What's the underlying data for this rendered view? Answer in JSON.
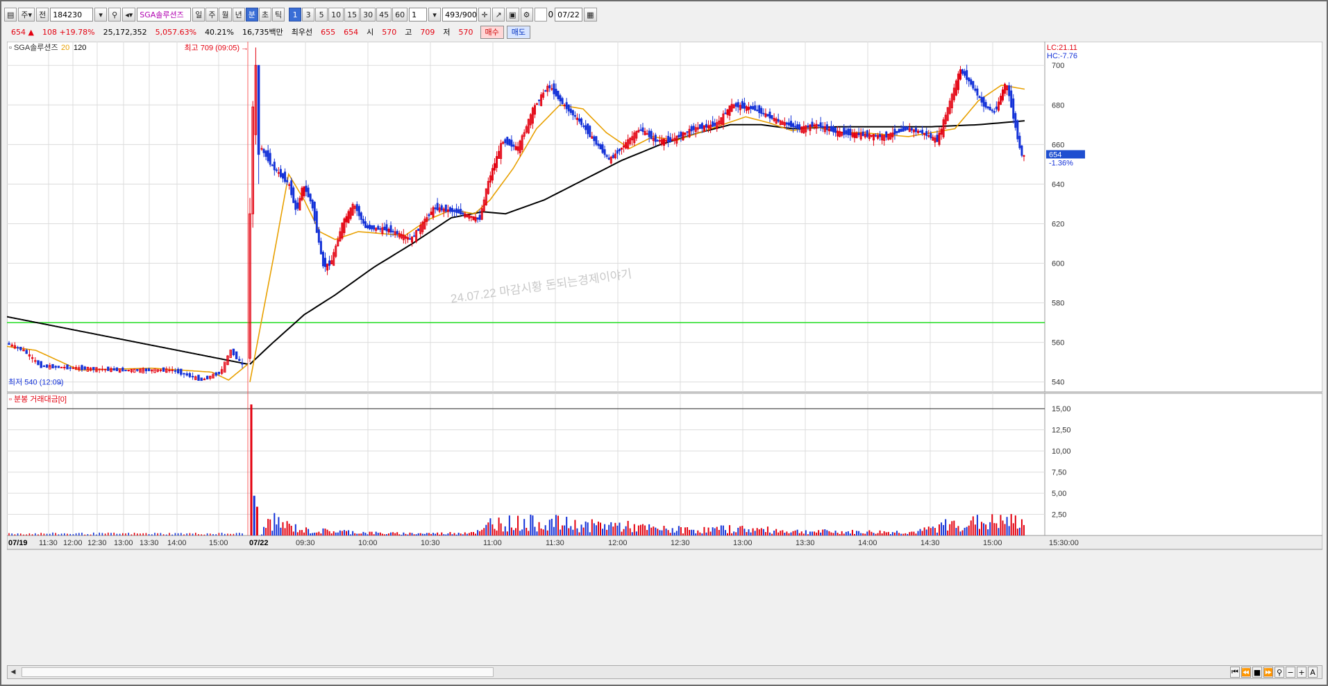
{
  "toolbar": {
    "type_code": "주",
    "market": "전",
    "code": "184230",
    "name": "SGA솔루션즈",
    "periods": [
      "일",
      "주",
      "월",
      "년",
      "분",
      "초",
      "틱"
    ],
    "selected_period": "분",
    "intervals": [
      "1",
      "3",
      "5",
      "10",
      "15",
      "30",
      "45",
      "60"
    ],
    "selected_interval": "1",
    "interval_select": "1",
    "count": "493",
    "count_total": "/900",
    "date": "07/22",
    "check_label": "0"
  },
  "quote": {
    "price": "654",
    "arrow": "▲",
    "change": "108",
    "change_pct": "+19.78%",
    "volume": "25,172,352",
    "vol_ratio": "5,057.63%",
    "turnover": "40.21%",
    "amount": "16,735백만",
    "best_label": "최우선",
    "ask": "655",
    "bid": "654",
    "open_label": "시",
    "open": "570",
    "high_label": "고",
    "high": "709",
    "low_label": "저",
    "low": "570",
    "buy_label": "매수",
    "sell_label": "매도"
  },
  "colors": {
    "up": "#e3000f",
    "down": "#1432d8",
    "ma20": "#e8a000",
    "ma120": "#000000",
    "hline": "#22dd22",
    "grid": "#dcdcdc"
  },
  "chart_data": [
    {
      "type": "candlestick",
      "legend": [
        "SGA솔루션즈",
        "20",
        "120"
      ],
      "high_marker": "최고 709 (09:05)",
      "low_marker": "최저 540 (12:09)",
      "right_top": [
        "LC:21.11",
        "HC:-7.76"
      ],
      "current": {
        "price": "654",
        "pct": "-1.36%"
      },
      "watermark": "24.07.22 마감시황   돈되는경제이야기",
      "yticks": [
        700,
        680,
        660,
        640,
        620,
        600,
        580,
        560,
        540
      ],
      "ylim": [
        535,
        712
      ],
      "reference_line": 570,
      "day1": {
        "open": 560,
        "close": 547,
        "high": 563,
        "low": 540
      },
      "spike_candles": [
        {
          "o": 552,
          "h": 633,
          "l": 550,
          "c": 625
        },
        {
          "o": 625,
          "h": 682,
          "l": 618,
          "c": 679
        },
        {
          "o": 665,
          "h": 709,
          "l": 660,
          "c": 700
        },
        {
          "o": 700,
          "h": 700,
          "l": 640,
          "c": 655
        }
      ],
      "close_path": [
        [
          0.0,
          660
        ],
        [
          0.02,
          648
        ],
        [
          0.04,
          640
        ],
        [
          0.05,
          625
        ],
        [
          0.058,
          640
        ],
        [
          0.07,
          630
        ],
        [
          0.085,
          598
        ],
        [
          0.095,
          600
        ],
        [
          0.11,
          620
        ],
        [
          0.125,
          630
        ],
        [
          0.14,
          618
        ],
        [
          0.17,
          617
        ],
        [
          0.2,
          612
        ],
        [
          0.23,
          628
        ],
        [
          0.26,
          626
        ],
        [
          0.29,
          622
        ],
        [
          0.3,
          640
        ],
        [
          0.32,
          662
        ],
        [
          0.34,
          658
        ],
        [
          0.36,
          678
        ],
        [
          0.38,
          690
        ],
        [
          0.4,
          680
        ],
        [
          0.42,
          672
        ],
        [
          0.44,
          662
        ],
        [
          0.46,
          652
        ],
        [
          0.48,
          660
        ],
        [
          0.5,
          668
        ],
        [
          0.52,
          662
        ],
        [
          0.54,
          662
        ],
        [
          0.57,
          668
        ],
        [
          0.6,
          670
        ],
        [
          0.62,
          680
        ],
        [
          0.65,
          678
        ],
        [
          0.68,
          672
        ],
        [
          0.71,
          668
        ],
        [
          0.73,
          670
        ],
        [
          0.76,
          666
        ],
        [
          0.79,
          665
        ],
        [
          0.82,
          664
        ],
        [
          0.85,
          668
        ],
        [
          0.87,
          666
        ],
        [
          0.89,
          662
        ],
        [
          0.92,
          698
        ],
        [
          0.935,
          690
        ],
        [
          0.95,
          680
        ],
        [
          0.965,
          676
        ],
        [
          0.98,
          692
        ],
        [
          1.0,
          654
        ]
      ],
      "ma20_path": [
        [
          0.0,
          540
        ],
        [
          0.03,
          602
        ],
        [
          0.05,
          645
        ],
        [
          0.07,
          632
        ],
        [
          0.09,
          616
        ],
        [
          0.11,
          612
        ],
        [
          0.14,
          616
        ],
        [
          0.17,
          615
        ],
        [
          0.2,
          614
        ],
        [
          0.23,
          622
        ],
        [
          0.26,
          627
        ],
        [
          0.29,
          625
        ],
        [
          0.31,
          632
        ],
        [
          0.34,
          648
        ],
        [
          0.37,
          668
        ],
        [
          0.4,
          680
        ],
        [
          0.43,
          678
        ],
        [
          0.46,
          666
        ],
        [
          0.49,
          658
        ],
        [
          0.52,
          664
        ],
        [
          0.55,
          662
        ],
        [
          0.58,
          666
        ],
        [
          0.61,
          670
        ],
        [
          0.64,
          674
        ],
        [
          0.67,
          671
        ],
        [
          0.7,
          667
        ],
        [
          0.73,
          669
        ],
        [
          0.76,
          666
        ],
        [
          0.79,
          666
        ],
        [
          0.82,
          665
        ],
        [
          0.85,
          664
        ],
        [
          0.88,
          666
        ],
        [
          0.91,
          668
        ],
        [
          0.94,
          682
        ],
        [
          0.97,
          690
        ],
        [
          1.0,
          688
        ]
      ],
      "ma120_path_day1": [
        [
          0.0,
          573
        ],
        [
          1.0,
          549
        ]
      ],
      "ma120_path": [
        [
          0.0,
          549
        ],
        [
          0.03,
          560
        ],
        [
          0.07,
          574
        ],
        [
          0.11,
          584
        ],
        [
          0.16,
          598
        ],
        [
          0.21,
          610
        ],
        [
          0.26,
          623
        ],
        [
          0.3,
          626
        ],
        [
          0.33,
          625
        ],
        [
          0.38,
          632
        ],
        [
          0.43,
          642
        ],
        [
          0.48,
          652
        ],
        [
          0.53,
          660
        ],
        [
          0.58,
          666
        ],
        [
          0.62,
          670
        ],
        [
          0.66,
          670
        ],
        [
          0.7,
          668
        ],
        [
          0.76,
          669
        ],
        [
          0.82,
          669
        ],
        [
          0.88,
          669
        ],
        [
          0.94,
          670
        ],
        [
          1.0,
          672
        ]
      ]
    },
    {
      "type": "bar",
      "legend": "분봉 거래대금[0]",
      "yticks": [
        "15,00",
        "12,50",
        "10,00",
        "7,50",
        "5,00",
        "2,50"
      ],
      "ylim": [
        0,
        16
      ],
      "reference_line": 15,
      "spike_bars": [
        {
          "v": 15.5,
          "up": true
        },
        {
          "v": 4.7,
          "up": false
        },
        {
          "v": 3.4,
          "up": true
        }
      ],
      "activity_profile": [
        [
          0.0,
          0.35
        ],
        [
          0.01,
          2.2
        ],
        [
          0.03,
          1.5
        ],
        [
          0.06,
          0.7
        ],
        [
          0.1,
          0.6
        ],
        [
          0.16,
          0.3
        ],
        [
          0.24,
          0.3
        ],
        [
          0.29,
          0.6
        ],
        [
          0.3,
          1.9
        ],
        [
          0.34,
          1.8
        ],
        [
          0.38,
          1.9
        ],
        [
          0.42,
          1.4
        ],
        [
          0.46,
          1.5
        ],
        [
          0.52,
          0.9
        ],
        [
          0.58,
          0.8
        ],
        [
          0.62,
          1.0
        ],
        [
          0.7,
          0.6
        ],
        [
          0.78,
          0.5
        ],
        [
          0.86,
          0.5
        ],
        [
          0.9,
          1.6
        ],
        [
          0.94,
          1.9
        ],
        [
          1.0,
          2.0
        ]
      ]
    }
  ],
  "xaxis": {
    "day1_label": "07/19",
    "day1_ticks": [
      "11:30",
      "12:00",
      "12:30",
      "13:00",
      "13:30",
      "14:00",
      "15:00"
    ],
    "day2_label": "07/22",
    "day2_ticks": [
      "09:30",
      "10:00",
      "10:30",
      "11:00",
      "11:30",
      "12:00",
      "12:30",
      "13:00",
      "13:30",
      "14:00",
      "14:30",
      "15:00"
    ],
    "end_label": "15:30:00"
  }
}
